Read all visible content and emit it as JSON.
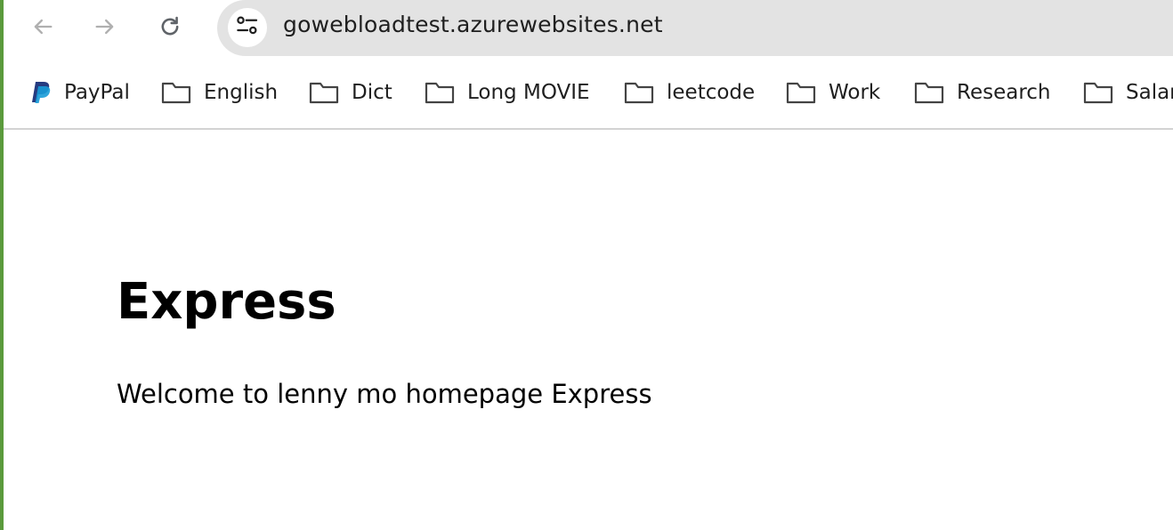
{
  "browser": {
    "url": "gowebloadtest.azurewebsites.net",
    "nav": {
      "back_icon": "arrow-left-icon",
      "forward_icon": "arrow-right-icon",
      "reload_icon": "reload-icon",
      "site_info_icon": "tune-icon"
    }
  },
  "bookmarks": [
    {
      "label": "PayPal",
      "icon": "paypal-logo"
    },
    {
      "label": "English",
      "icon": "folder-icon"
    },
    {
      "label": "Dict",
      "icon": "folder-icon"
    },
    {
      "label": "Long MOVIE",
      "icon": "folder-icon"
    },
    {
      "label": "leetcode",
      "icon": "folder-icon"
    },
    {
      "label": "Work",
      "icon": "folder-icon"
    },
    {
      "label": "Research",
      "icon": "folder-icon"
    },
    {
      "label": "Salar",
      "icon": "folder-icon"
    }
  ],
  "page": {
    "title": "Express",
    "message": "Welcome to lenny mo homepage Express"
  },
  "colors": {
    "omnibox_bg": "#e3e3e3",
    "icon_gray": "#5f6368",
    "disabled_gray": "#b0b0b0",
    "paypal_dark": "#253b80",
    "paypal_light": "#179bd7",
    "window_edge": "#5a9a3c"
  }
}
